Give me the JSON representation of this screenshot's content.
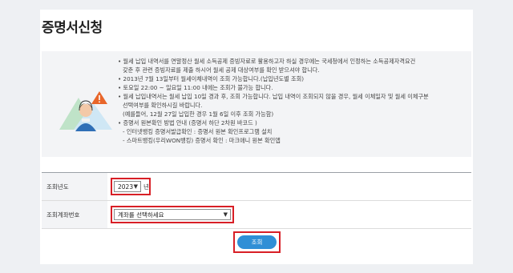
{
  "page": {
    "title": "증명서신청"
  },
  "notice": {
    "items": [
      {
        "type": "bul",
        "text": "월세 납입 내역서를 연말정산 월세 소득공제 증빙자료로 활용하고자 하실 경우에는 국세청에서 인정하는 소득공제자격요건"
      },
      {
        "type": "cont",
        "text": "갖춘 후 관련 증빙자료를 제출 하시어 월세 공제 대상여부를 확인 받으셔야 합니다."
      },
      {
        "type": "bul",
        "text": "2013년 7월 13일부터 월세이체내역이 조회 가능합니다.(납입년도별 조회)"
      },
      {
        "type": "bul",
        "text": "토요일 22:00 ~ 일요일 11:00 내에는 조회가 불가능 합니다."
      },
      {
        "type": "bul",
        "text": "월세 납입내역서는 월세 납입 10일 경과 후, 조회 가능합니다. 납입 내역이 조회되지 않을 경우, 월세 이체일자 및 월세 이체구분"
      },
      {
        "type": "cont",
        "text": "선택여부를 확인하시길 바랍니다."
      },
      {
        "type": "cont",
        "text": "(예를들어, 12월 27일 납입한 경우 1월 6일 이후 조회 가능함)"
      },
      {
        "type": "bul",
        "text": "증명서 원본확인 방법 안내 (증명서 하단 2차원 바코드 )"
      },
      {
        "type": "sub",
        "text": "- 인터넷뱅킹 증명서발급확인 : 증명서 원본 확인프로그램 설치"
      },
      {
        "type": "sub",
        "text": "- 스마트뱅킹(우리WON뱅킹) 증명서 확인 : 마크애니 원본 확인앱"
      }
    ]
  },
  "form": {
    "year_label": "조회년도",
    "year_value": "2023",
    "year_unit": "년",
    "account_label": "조회계좌번호",
    "account_placeholder": "계좌를 선택하세요"
  },
  "actions": {
    "search_label": "조회"
  },
  "colors": {
    "highlight": "#d81f26",
    "button": "#2f8fd6",
    "accent_orange": "#e8662a"
  },
  "icons": {
    "select_arrow": "chevron-down-icon",
    "illustration": "call-center-agent-illustration",
    "warning": "warning-icon"
  }
}
